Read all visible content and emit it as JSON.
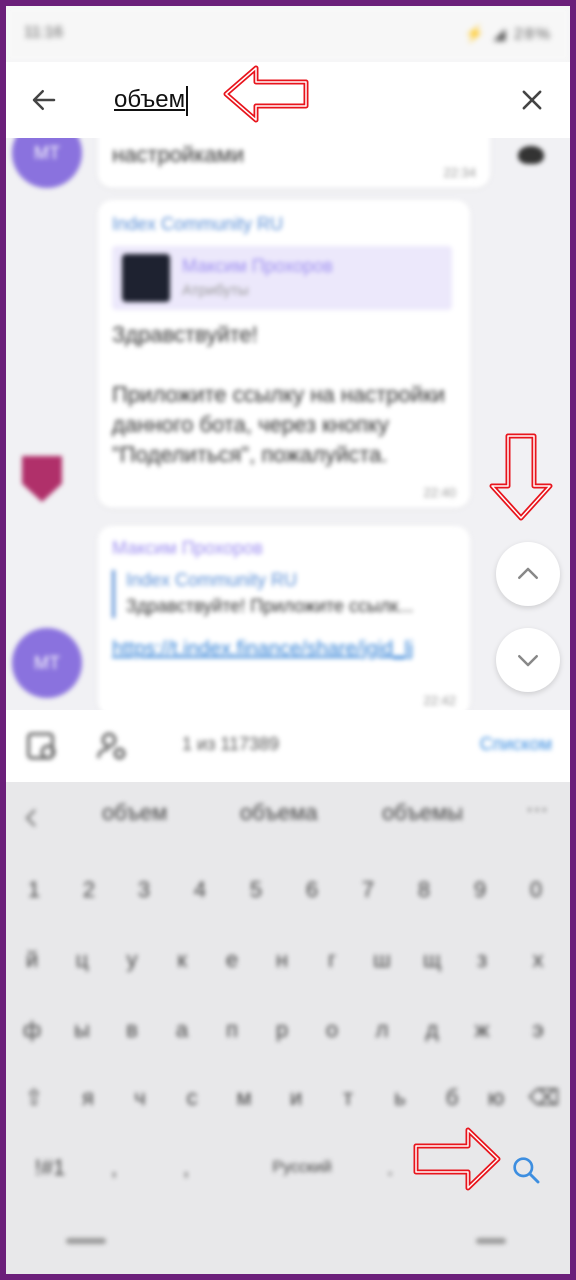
{
  "status_bar": {
    "time": "11:16",
    "right": "⚡ ◢ 28%"
  },
  "search": {
    "query": "объем",
    "back_icon": "arrow-left-icon",
    "close_icon": "close-icon"
  },
  "chat": {
    "messages": [
      {
        "sender": "",
        "text": "настройками",
        "time": "22:34",
        "avatar": "MT"
      },
      {
        "sender": "Index Community RU",
        "quote_sender": "Максим Прохоров",
        "quote_sub": "Атрибуты",
        "text": "Здравствуйте!\n\nПриложите ссылку на настройки данного бота, через кнопку \"Поделиться\", пожалуйста.",
        "time": "22:40"
      },
      {
        "sender": "Максим Прохоров",
        "reply_sender": "Index Community RU",
        "reply_text": "Здравствуйте! Приложите ссылк...",
        "link": "https://t.index.finance/share/jgid_lj",
        "time": "22:42",
        "avatar": "MT"
      }
    ]
  },
  "results": {
    "count": "1 из 117389",
    "list_label": "Списком"
  },
  "keyboard": {
    "suggestions": [
      "объем",
      "объема",
      "объемы"
    ],
    "row_digits": [
      "1",
      "2",
      "3",
      "4",
      "5",
      "6",
      "7",
      "8",
      "9",
      "0"
    ],
    "row1": [
      "й",
      "ц",
      "у",
      "к",
      "е",
      "н",
      "г",
      "ш",
      "щ",
      "з",
      "х"
    ],
    "row2": [
      "ф",
      "ы",
      "в",
      "а",
      "п",
      "р",
      "о",
      "л",
      "д",
      "ж",
      "э"
    ],
    "row3": [
      "я",
      "ч",
      "с",
      "м",
      "и",
      "т",
      "ь",
      "б",
      "ю"
    ],
    "bottom": {
      "sym": "!#1",
      "comma": ",",
      "space": "Русский",
      "period": "."
    }
  },
  "colors": {
    "annotation": "#e8141c",
    "accent": "#3d8ee0",
    "frame": "#6b1f7a"
  }
}
